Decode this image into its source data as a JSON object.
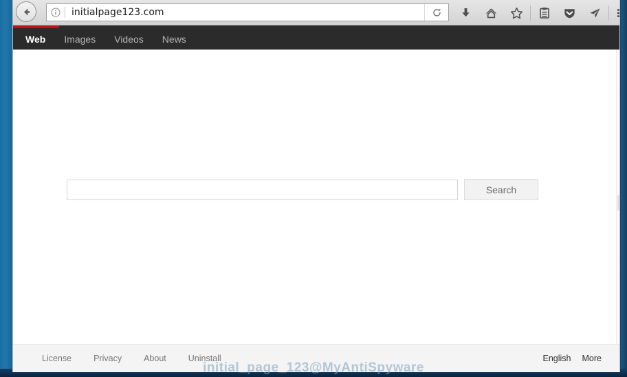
{
  "browser": {
    "back_button": "back-arrow",
    "url": "initialpage123.com",
    "identity_icon": "info-icon",
    "reload_icon": "reload-icon",
    "toolbar_icons": [
      {
        "name": "download-icon",
        "label": "Downloads"
      },
      {
        "name": "home-icon",
        "label": "Home"
      },
      {
        "name": "star-icon",
        "label": "Bookmark"
      },
      {
        "name": "library-icon",
        "label": "Library"
      },
      {
        "name": "shield-icon",
        "label": "Pocket"
      },
      {
        "name": "send-icon",
        "label": "Send"
      },
      {
        "name": "hamburger-menu-icon",
        "label": "Open menu"
      }
    ]
  },
  "site_nav": {
    "tabs": [
      {
        "label": "Web",
        "active": true
      },
      {
        "label": "Images",
        "active": false
      },
      {
        "label": "Videos",
        "active": false
      },
      {
        "label": "News",
        "active": false
      }
    ],
    "progress_color": "#c1121c"
  },
  "search": {
    "value": "",
    "placeholder": "",
    "button_label": "Search"
  },
  "footer": {
    "links": [
      "License",
      "Privacy",
      "About",
      "Uninstall"
    ],
    "right_links": [
      "English",
      "More"
    ]
  },
  "watermark": {
    "text": "initial_page_123@MyAntiSpyware"
  }
}
